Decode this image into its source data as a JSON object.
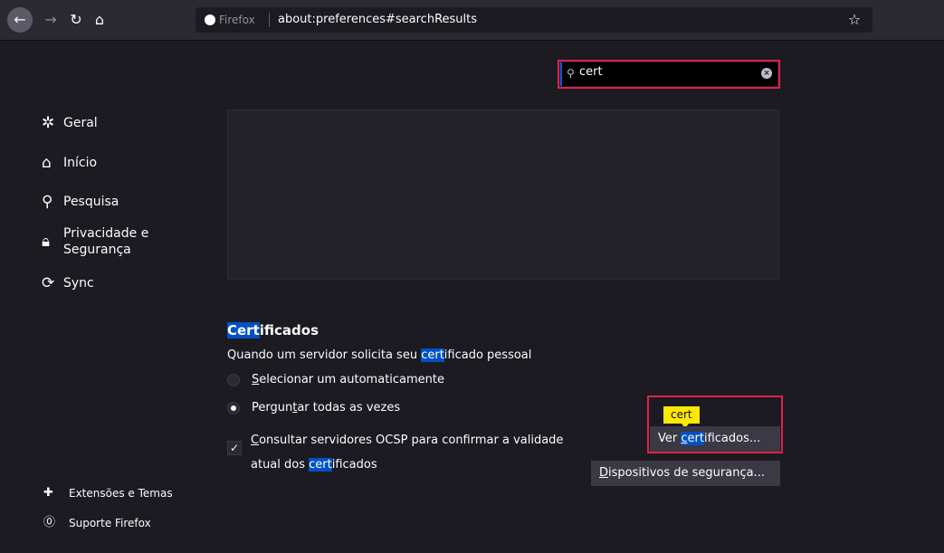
{
  "browser": {
    "identity_label": "Firefox",
    "url": "about:preferences#searchResults",
    "icons": [
      "back-arrow-icon",
      "forward-arrow-icon",
      "reload-icon",
      "home-icon",
      "firefox-icon",
      "star-icon"
    ]
  },
  "search": {
    "value": "cert",
    "icon": "search-icon",
    "clear_icon": "clear-icon"
  },
  "sidebar": {
    "items": [
      {
        "label": "Geral",
        "icon": "gear-icon"
      },
      {
        "label": "Início",
        "icon": "home-icon"
      },
      {
        "label": "Pesquisa",
        "icon": "search-icon"
      },
      {
        "label_line1": "Privacidade e",
        "label_line2": "Segurança",
        "icon": "lock-icon"
      },
      {
        "label": "Sync",
        "icon": "sync-icon"
      }
    ],
    "bottom": [
      {
        "label": "Extensões e Temas",
        "icon": "puzzle-icon"
      },
      {
        "label": "Suporte Firefox",
        "icon": "help-icon"
      }
    ]
  },
  "certificates": {
    "title_hl": "Cert",
    "title_rest": "ificados",
    "desc_before": "Quando um servidor solicita seu ",
    "desc_hl": "cert",
    "desc_after": "ificado pessoal",
    "radio_auto": {
      "underline": "S",
      "rest": "elecionar um automaticamente",
      "checked": false
    },
    "radio_ask": {
      "before": "Pergun",
      "underline": "t",
      "after": "ar todas as vezes",
      "checked": true
    },
    "ocsp": {
      "line1_underline": "C",
      "line1_rest": "onsultar servidores OCSP para confirmar a validade",
      "line2_before": "atual dos ",
      "line2_hl": "cert",
      "line2_after": "ificados",
      "checked": true,
      "check_glyph": "✓"
    },
    "hint_tag": "cert",
    "view_button": {
      "before": "Ver ",
      "hl_underline": "c",
      "hl_rest": "ert",
      "after": "ificados..."
    },
    "devices_button": {
      "underline": "D",
      "rest": "ispositivos de segurança..."
    }
  },
  "colors": {
    "accent": "#0060df",
    "highlight": "#0051c3",
    "annotation_red": "#e0204a",
    "hint_yellow": "#ffe900",
    "background": "#1c1b22"
  }
}
